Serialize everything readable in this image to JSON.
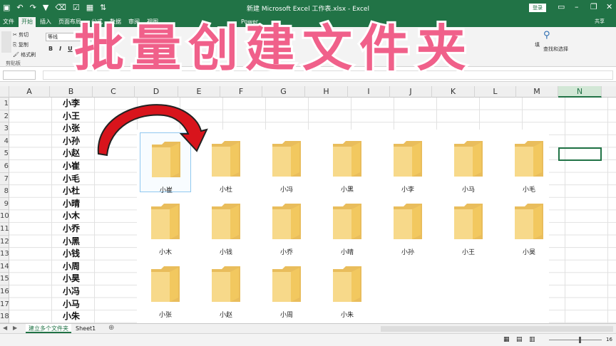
{
  "window": {
    "title": "新建 Microsoft Excel 工作表.xlsx - Excel",
    "login_label": "登录",
    "share_label": "共享"
  },
  "tabs": [
    "文件",
    "开始",
    "插入",
    "页面布局",
    "公式",
    "数据",
    "审阅",
    "视图",
    "Power"
  ],
  "active_tab": "开始",
  "ribbon": {
    "clipboard": {
      "cut": "剪切",
      "copy": "复制",
      "format_painter": "格式刷",
      "group_label": "剪贴板"
    },
    "font_name": "等线",
    "format_buttons": [
      "B",
      "I",
      "U"
    ],
    "edit_labels": [
      "填",
      "查找和选择"
    ]
  },
  "overlay_title": "批量创建文件夹",
  "grid": {
    "columns": [
      "A",
      "B",
      "C",
      "D",
      "E",
      "F",
      "G",
      "H",
      "I",
      "J",
      "K",
      "L",
      "M",
      "N"
    ],
    "selected_column": "N",
    "rows": [
      "1",
      "2",
      "3",
      "4",
      "5",
      "6",
      "7",
      "8",
      "9",
      "10",
      "11",
      "12",
      "13",
      "14",
      "15",
      "16",
      "17",
      "18"
    ],
    "column_b_values": [
      "小李",
      "小王",
      "小张",
      "小孙",
      "小赵",
      "小崔",
      "小毛",
      "小杜",
      "小晴",
      "小木",
      "小乔",
      "小黑",
      "小钱",
      "小周",
      "小昊",
      "小冯",
      "小马",
      "小朱"
    ]
  },
  "folders": [
    [
      "小崔",
      "小杜",
      "小冯",
      "小黑",
      "小李",
      "小马",
      "小毛"
    ],
    [
      "小木",
      "小钱",
      "小乔",
      "小晴",
      "小孙",
      "小王",
      "小昊"
    ],
    [
      "小张",
      "小赵",
      "小周",
      "小朱"
    ]
  ],
  "sheets": [
    "建立多个文件夹",
    "Sheet1"
  ],
  "active_sheet": "建立多个文件夹",
  "zoom_label": "16",
  "colors": {
    "excel_green": "#217346",
    "title_pink": "#f0608a",
    "arrow_red": "#d8141c",
    "folder_yellow": "#f5d27a"
  },
  "icons": {
    "save": "save-icon",
    "undo": "undo-icon",
    "redo": "redo-icon",
    "folder": "folder-icon",
    "curved_arrow": "curved-arrow-icon"
  }
}
